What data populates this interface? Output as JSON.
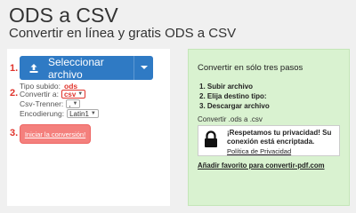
{
  "header": {
    "title": "ODS a CSV",
    "subtitle": "Convertir en línea y gratis ODS a CSV"
  },
  "form": {
    "steps": [
      "1.",
      "2.",
      "3."
    ],
    "upload_label": "Seleccionar archivo",
    "file_type_label": "Tipo subido:",
    "file_type_value": "ods",
    "convert_to_label": "Convertir a:",
    "convert_to_value": "csv",
    "separator_label": "Csv-Trenner:",
    "separator_value": ",",
    "encoding_label": "Encodierung:",
    "encoding_value": "Latin1",
    "start_label": "Iniciar la conversión!"
  },
  "info": {
    "title": "Convertir en sólo tres pasos",
    "steps": [
      "Subir archivo",
      "Elija destino tipo:",
      "Descargar archivo"
    ],
    "convert_line": "Convertir .ods a .csv",
    "privacy_line1": "¡Respetamos tu privacidad! Su",
    "privacy_line2": "conexión está encriptada.",
    "privacy_link": "Política de Privacidad",
    "favorite_link": "Añadir favorito para convertir-pdf.com"
  },
  "colors": {
    "accent": "#2f7ac4",
    "step_number": "#e0332b",
    "start_button": "#f4807d",
    "info_panel": "#d9f2d0"
  }
}
